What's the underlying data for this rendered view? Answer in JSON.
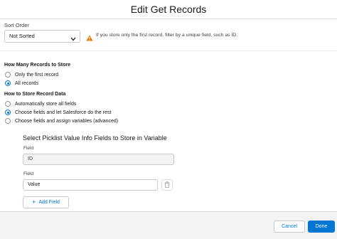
{
  "dialog": {
    "title": "Edit Get Records"
  },
  "sort": {
    "label": "Sort Order",
    "selected": "Not Sorted",
    "warning": "If you store only the first record, filter by a unique field, such as ID."
  },
  "records_to_store": {
    "title": "How Many Records to Store",
    "options": [
      {
        "label": "Only the first record",
        "checked": false
      },
      {
        "label": "All records",
        "checked": true
      }
    ]
  },
  "record_data": {
    "title": "How to Store Record Data",
    "options": [
      {
        "label": "Automatically store all fields",
        "checked": false
      },
      {
        "label": "Choose fields and let Salesforce do the rest",
        "checked": true
      },
      {
        "label": "Choose fields and assign variables (advanced)",
        "checked": false
      }
    ]
  },
  "picklist": {
    "title": "Select Picklist Value Info Fields to Store in Variable",
    "fields": [
      {
        "label": "Field",
        "value": "ID"
      },
      {
        "label": "Field",
        "value": "Value"
      }
    ],
    "add_field_label": "Add Field"
  },
  "footer": {
    "cancel_label": "Cancel",
    "done_label": "Done"
  },
  "colors": {
    "accent": "#0176d3",
    "warning": "#dd7a01",
    "footer_bg": "#f3f3f3"
  },
  "icons": [
    "chevron-down-icon",
    "warning-icon",
    "trash-icon",
    "plus-icon"
  ]
}
